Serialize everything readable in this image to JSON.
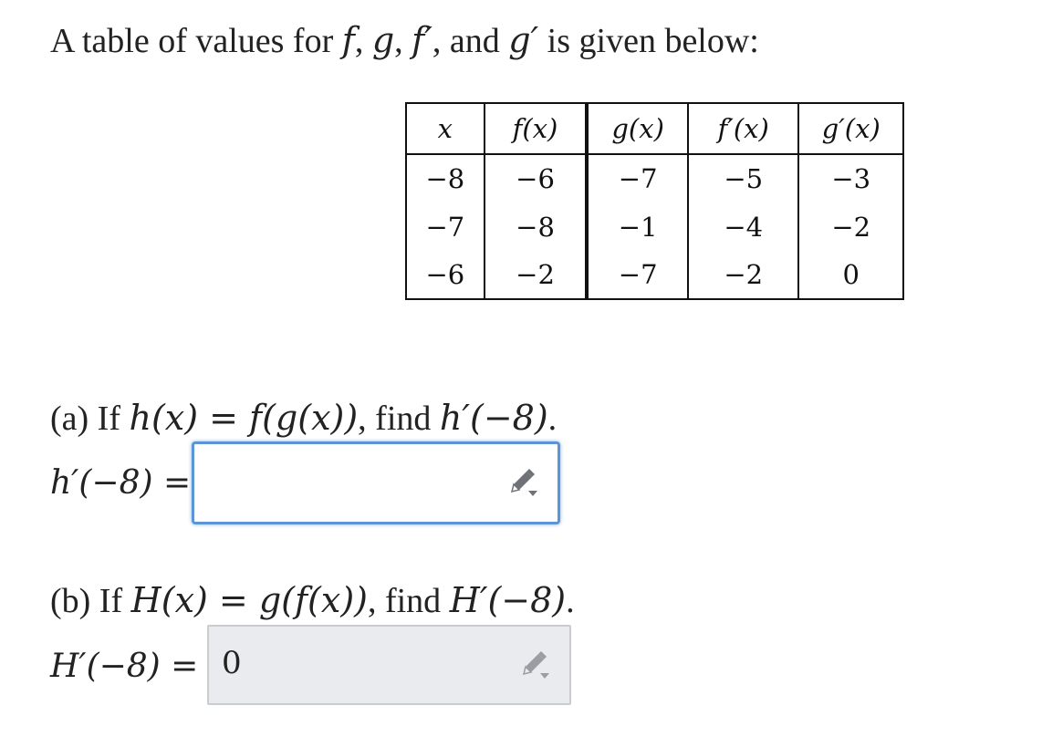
{
  "intro": {
    "text_before": "A table of values for ",
    "f": "f",
    "sep1": ", ",
    "g": "g",
    "sep2": ", ",
    "f_prime": "f′",
    "sep3": ", and ",
    "g_prime": "g′",
    "text_after": " is given below:"
  },
  "table": {
    "headers": [
      "x",
      "f(x)",
      "g(x)",
      "f′(x)",
      "g′(x)"
    ],
    "rows": [
      [
        "−8",
        "−6",
        "−7",
        "−5",
        "−3"
      ],
      [
        "−7",
        "−8",
        "−1",
        "−4",
        "−2"
      ],
      [
        "−6",
        "−2",
        "−7",
        "−2",
        "0"
      ]
    ]
  },
  "part_a": {
    "prefix": "(a) If ",
    "definition": "h(x) = f(g(x))",
    "middle": ", find ",
    "target": "h′(−8)",
    "suffix": ".",
    "answer_label": "h′(−8) =",
    "answer_value": ""
  },
  "part_b": {
    "prefix": "(b) If ",
    "definition": "H(x) = g(f(x))",
    "middle": ", find ",
    "target": "H′(−8)",
    "suffix": ".",
    "answer_label": "H′(−8) =",
    "answer_value": "0"
  },
  "icons": {
    "edit": "pencil-icon"
  },
  "colors": {
    "active_border": "#5b95d6",
    "disabled_fill": "#e9ebee",
    "icon_gray": "#6f7378"
  }
}
